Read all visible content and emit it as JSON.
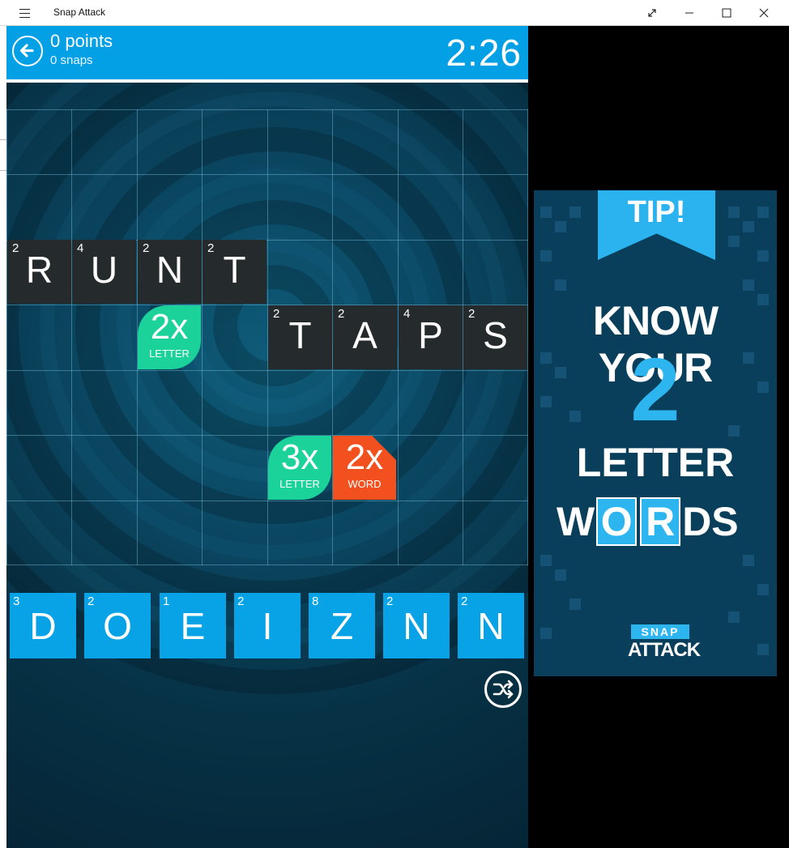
{
  "window": {
    "title": "Snap Attack",
    "menu_icon": "hamburger-icon",
    "controls": [
      "expand-icon",
      "minimize-icon",
      "maximize-icon",
      "close-icon"
    ]
  },
  "header": {
    "points": "0 points",
    "snaps": "0 snaps",
    "timer": "2:26",
    "back_icon": "back-arrow-icon",
    "color": "#04a0e6"
  },
  "board": {
    "row1": [
      {
        "letter": "R",
        "points": "2"
      },
      {
        "letter": "U",
        "points": "4"
      },
      {
        "letter": "N",
        "points": "2"
      },
      {
        "letter": "T",
        "points": "2"
      }
    ],
    "row2": [
      {
        "letter": "T",
        "points": "2"
      },
      {
        "letter": "A",
        "points": "2"
      },
      {
        "letter": "P",
        "points": "4"
      },
      {
        "letter": "S",
        "points": "2"
      }
    ],
    "bonuses": [
      {
        "value": "2x",
        "kind": "LETTER",
        "color": "#1ad29a"
      },
      {
        "value": "3x",
        "kind": "LETTER",
        "color": "#1ad29a"
      },
      {
        "value": "2x",
        "kind": "WORD",
        "color": "#f2511f"
      }
    ]
  },
  "rack": [
    {
      "letter": "D",
      "points": "3"
    },
    {
      "letter": "O",
      "points": "2"
    },
    {
      "letter": "E",
      "points": "1"
    },
    {
      "letter": "I",
      "points": "2"
    },
    {
      "letter": "Z",
      "points": "8"
    },
    {
      "letter": "N",
      "points": "2"
    },
    {
      "letter": "N",
      "points": "2"
    }
  ],
  "shuffle_icon": "shuffle-icon",
  "ad": {
    "tip": "TIP!",
    "line1": "KNOW YOUR",
    "number": "2",
    "line3": "LETTER",
    "words": {
      "a": "W",
      "b": "O",
      "c": "R",
      "d": "DS"
    },
    "logo_top": "SNAP",
    "logo_bottom": "ATTACK"
  }
}
